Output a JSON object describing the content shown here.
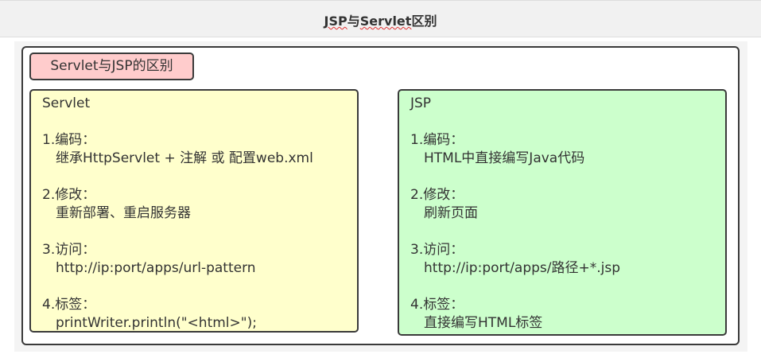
{
  "header": {
    "title_prefix": "JSP",
    "title_mid": "与",
    "title_servlet": "Servlet",
    "title_suffix": "区别"
  },
  "diagram": {
    "tag": "Servlet与JSP的区别",
    "servlet": {
      "title": "Servlet",
      "l1": "1.编码：",
      "v1": "继承HttpServlet + 注解 或 配置web.xml",
      "l2": "2.修改：",
      "v2": "重新部署、重启服务器",
      "l3": "3.访问：",
      "v3": "http://ip:port/apps/url-pattern",
      "l4": "4.标签：",
      "v4": "printWriter.println(\"<html>\");"
    },
    "jsp": {
      "title": "JSP",
      "l1": "1.编码：",
      "v1": "HTML中直接编写Java代码",
      "l2": "2.修改：",
      "v2": "刷新页面",
      "l3": "3.访问：",
      "v3": "http://ip:port/apps/路径+*.jsp",
      "l4": "4.标签：",
      "v4": "直接编写HTML标签"
    }
  },
  "colors": {
    "tag": "#ffcccc",
    "servlet": "#ffffcc",
    "jsp": "#ccffcc"
  }
}
